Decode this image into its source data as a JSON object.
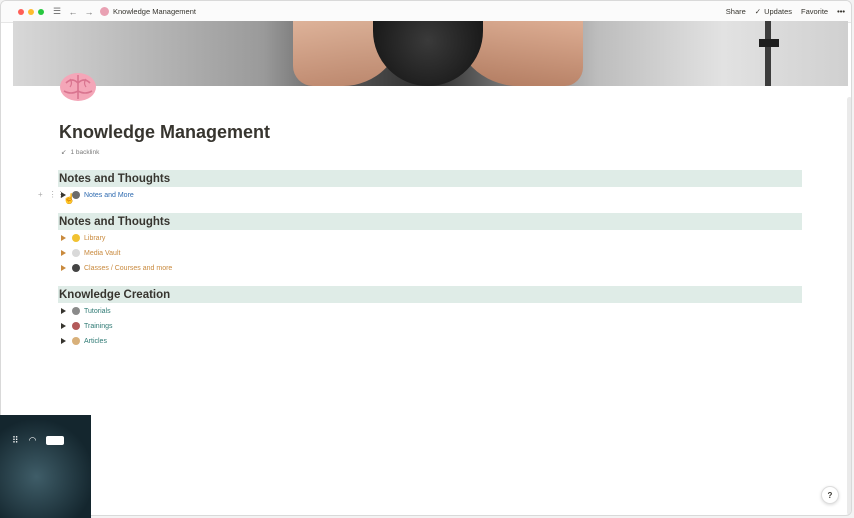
{
  "titlebar": {
    "page_title": "Knowledge Management",
    "share_label": "Share",
    "updates_label": "Updates",
    "favorite_label": "Favorite",
    "more_label": "•••",
    "dot_colors": [
      "#ff5f57",
      "#febc2e",
      "#28c840"
    ]
  },
  "page": {
    "title": "Knowledge Management",
    "backlink": "1 backlink"
  },
  "sections": [
    {
      "heading": "Notes and Thoughts",
      "items": [
        {
          "label": "Notes and More",
          "color": "#2f6bb0",
          "icon": "person-icon"
        }
      ]
    },
    {
      "heading": "Notes and Thoughts",
      "items": [
        {
          "label": "Library",
          "color": "#c98a3e",
          "icon": "smile-icon"
        },
        {
          "label": "Media Vault",
          "color": "#c98a3e",
          "icon": "disc-icon"
        },
        {
          "label": "Classes / Courses and more",
          "color": "#c98a3e",
          "icon": "graduation-icon"
        }
      ]
    },
    {
      "heading": "Knowledge Creation",
      "items": [
        {
          "label": "Tutorials",
          "color": "#2e7a74",
          "icon": "tools-icon"
        },
        {
          "label": "Trainings",
          "color": "#2e7a74",
          "icon": "weights-icon"
        },
        {
          "label": "Articles",
          "color": "#2e7a74",
          "icon": "scroll-icon"
        }
      ]
    }
  ],
  "help_label": "?"
}
